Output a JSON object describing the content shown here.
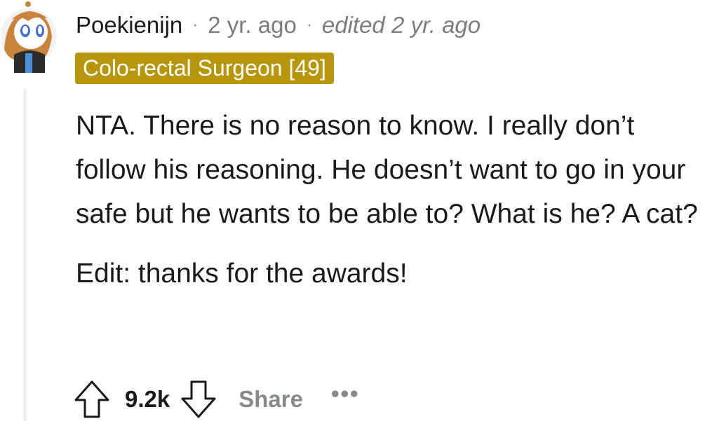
{
  "comment": {
    "username": "Poekienijn",
    "separator": "·",
    "posted": "2 yr. ago",
    "edited": "edited 2 yr. ago",
    "flair": "Colo-rectal Surgeon [49]",
    "paragraphs": [
      "NTA. There is no reason to know. I really don’t follow his reasoning. He doesn’t want to go in your safe but he wants to be able to? What is he? A cat?",
      "Edit: thanks for the awards!"
    ]
  },
  "actions": {
    "score": "9.2k",
    "share_label": "Share",
    "more_label": "•••"
  },
  "colors": {
    "flair_bg": "#b8960c",
    "meta_gray": "#7c7c7c",
    "thread_line": "#edeff1"
  },
  "icons": [
    "avatar",
    "upvote-icon",
    "downvote-icon",
    "more-icon"
  ]
}
